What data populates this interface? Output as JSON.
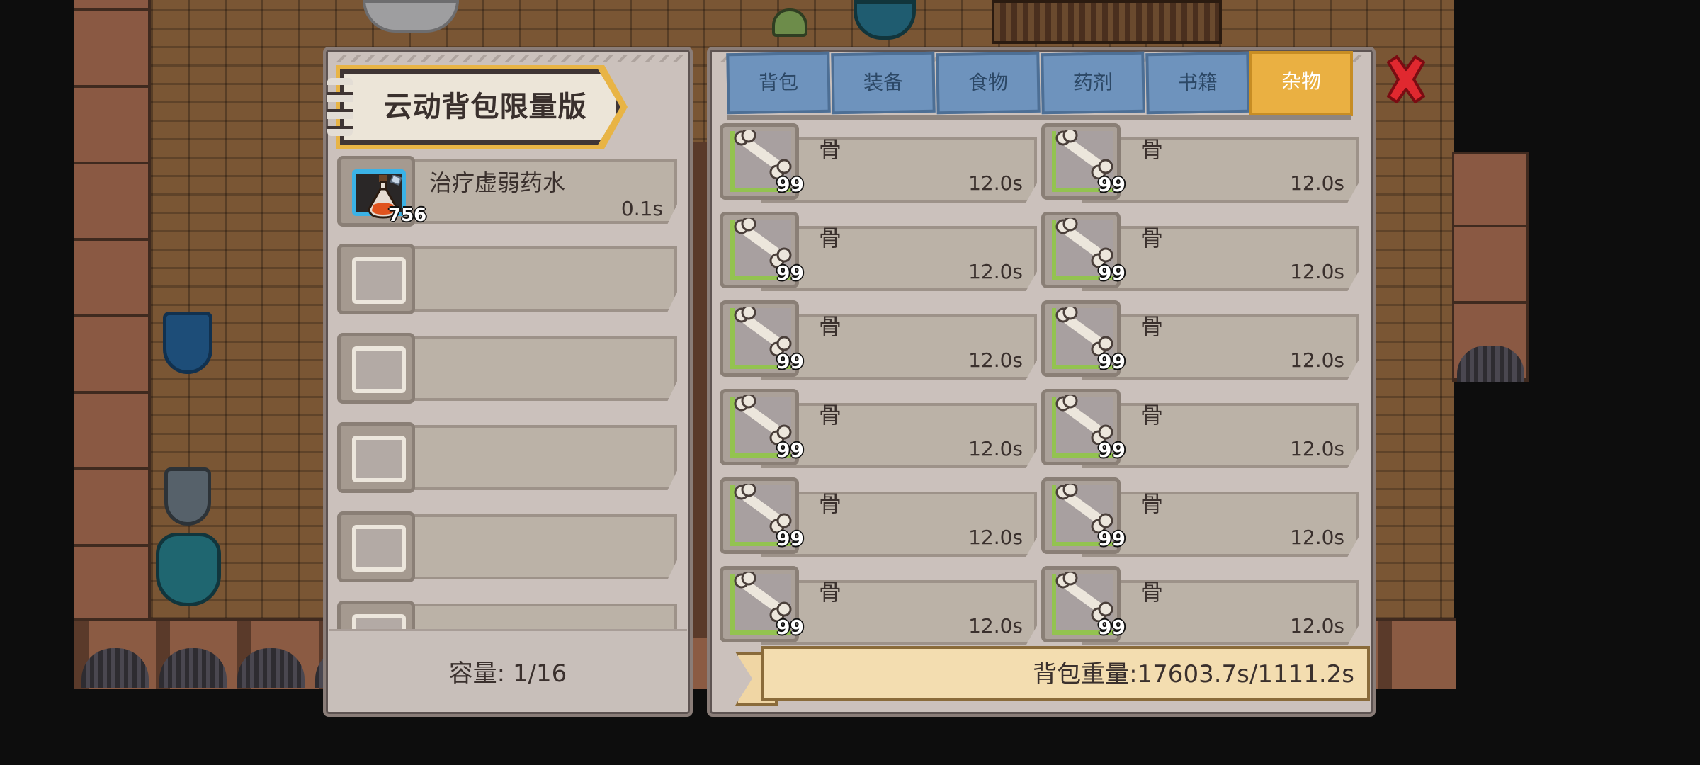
{
  "inventory": {
    "title": "云动背包限量版",
    "slots": [
      {
        "name": "治疗虚弱药水",
        "weight": "0.1s",
        "count": "756",
        "filled": true
      },
      {
        "name": "",
        "weight": "",
        "count": "",
        "filled": false
      },
      {
        "name": "",
        "weight": "",
        "count": "",
        "filled": false
      },
      {
        "name": "",
        "weight": "",
        "count": "",
        "filled": false
      },
      {
        "name": "",
        "weight": "",
        "count": "",
        "filled": false
      },
      {
        "name": "",
        "weight": "",
        "count": "",
        "filled": false
      }
    ],
    "capacity": "容量: 1/16"
  },
  "storage": {
    "tabs": [
      {
        "label": "背包",
        "active": false
      },
      {
        "label": "装备",
        "active": false
      },
      {
        "label": "食物",
        "active": false
      },
      {
        "label": "药剂",
        "active": false
      },
      {
        "label": "书籍",
        "active": false
      },
      {
        "label": "杂物",
        "active": true
      }
    ],
    "items": [
      {
        "name": "骨",
        "weight": "12.0s",
        "count": "99"
      },
      {
        "name": "骨",
        "weight": "12.0s",
        "count": "99"
      },
      {
        "name": "骨",
        "weight": "12.0s",
        "count": "99"
      },
      {
        "name": "骨",
        "weight": "12.0s",
        "count": "99"
      },
      {
        "name": "骨",
        "weight": "12.0s",
        "count": "99"
      },
      {
        "name": "骨",
        "weight": "12.0s",
        "count": "99"
      },
      {
        "name": "骨",
        "weight": "12.0s",
        "count": "99"
      },
      {
        "name": "骨",
        "weight": "12.0s",
        "count": "99"
      },
      {
        "name": "骨",
        "weight": "12.0s",
        "count": "99"
      },
      {
        "name": "骨",
        "weight": "12.0s",
        "count": "99"
      },
      {
        "name": "骨",
        "weight": "12.0s",
        "count": "99"
      },
      {
        "name": "骨",
        "weight": "12.0s",
        "count": "99"
      }
    ],
    "total_weight": "背包重量:17603.7s/1111.2s"
  },
  "colors": {
    "tab_active": "#eab042",
    "tab_inactive": "#6e93bd",
    "close_red": "#e0282f",
    "selected_slot": "#3bb2e6",
    "count_item_frame": "#93c350"
  },
  "icons": {
    "close": "close-x-icon",
    "potion": "potion-icon",
    "bone": "bone-icon"
  }
}
